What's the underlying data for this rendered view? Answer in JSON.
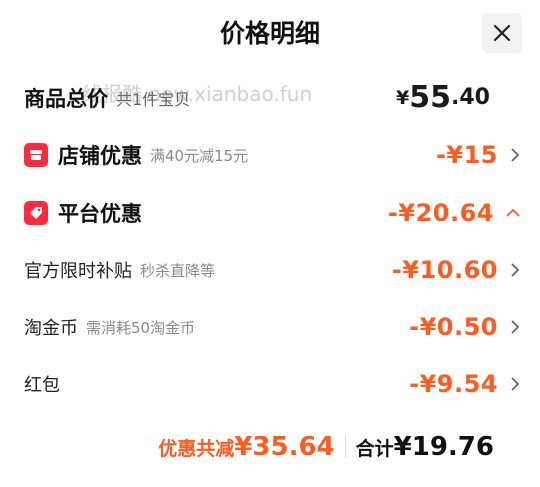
{
  "header": {
    "title": "价格明细",
    "close_icon": "close-icon"
  },
  "watermark": "线报酷 new.xianbao.fun",
  "rows": {
    "total": {
      "label": "商品总价",
      "desc": "共1件宝贝",
      "currency": "¥",
      "int": "55",
      "dec": ".40"
    },
    "store": {
      "label": "店铺优惠",
      "desc": "满40元减15元",
      "amount": "-¥15",
      "icon": "store-icon"
    },
    "platform": {
      "label": "平台优惠",
      "amount": "-¥20.64",
      "icon": "tag-icon",
      "expanded": true
    },
    "official": {
      "label": "官方限时补贴",
      "desc": "秒杀直降等",
      "amount": "-¥10.60"
    },
    "coins": {
      "label": "淘金币",
      "desc": "需消耗50淘金币",
      "amount": "-¥0.50"
    },
    "redpacket": {
      "label": "红包",
      "amount": "-¥9.54"
    }
  },
  "footer": {
    "save_label": "优惠共减",
    "save_amount": "¥35.64",
    "sum_label": "合计",
    "sum_amount": "¥19.76"
  },
  "colors": {
    "accent": "#ff5a1f",
    "badge": "#ff2a3d",
    "text": "#111111",
    "muted": "#8a8a8a"
  }
}
